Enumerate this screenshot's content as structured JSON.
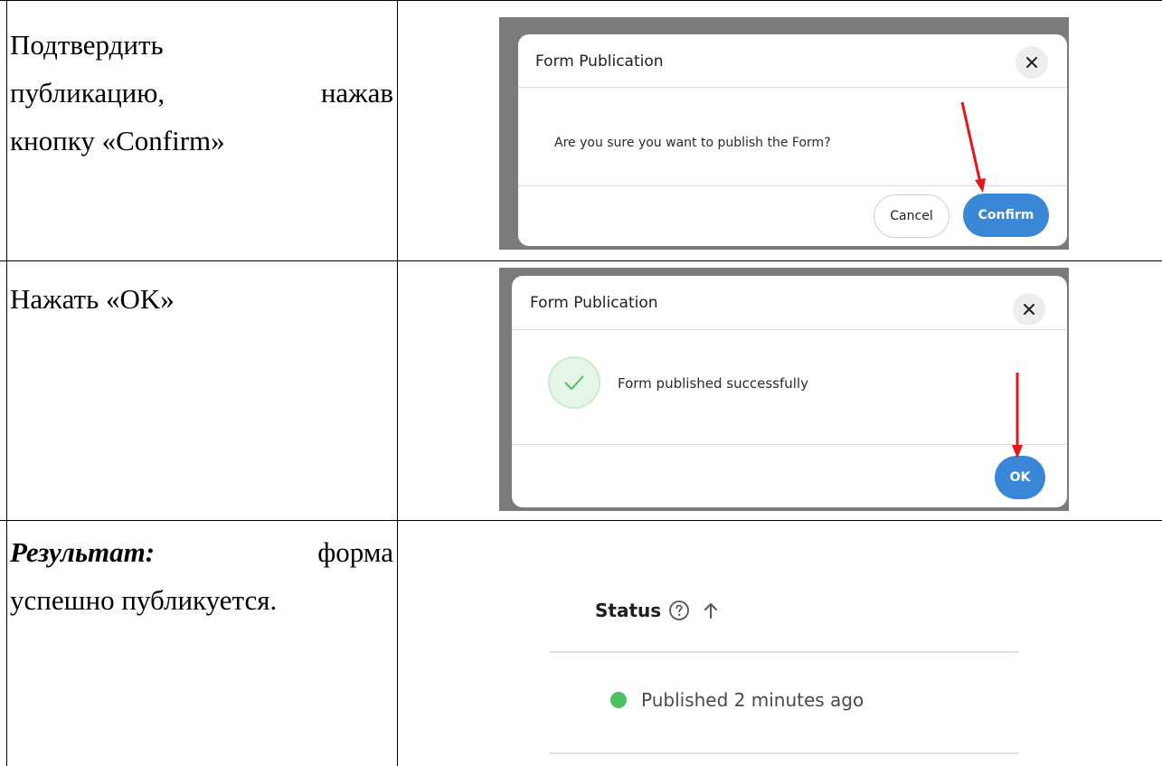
{
  "rows": [
    {
      "instruction_lines": [
        {
          "type": "plain",
          "text": "Подтвердить"
        },
        {
          "type": "justify",
          "left": "публикацию,",
          "right": "нажав"
        },
        {
          "type": "plain",
          "text": "кнопку «Confirm»"
        }
      ],
      "dialog": {
        "title": "Form Publication",
        "message": "Are you sure you want to publish the Form?",
        "cancel_label": "Cancel",
        "confirm_label": "Confirm"
      }
    },
    {
      "instruction_lines": [
        {
          "type": "plain",
          "text": "Нажать «OK»"
        }
      ],
      "dialog": {
        "title": "Form Publication",
        "message": "Form published successfully",
        "ok_label": "OK"
      }
    },
    {
      "result_label": "Результат:",
      "result_word": "форма",
      "result_line2": "успешно публикуется.",
      "status": {
        "header": "Status",
        "value": "Published 2 minutes ago",
        "dot_color": "#4cc063"
      }
    }
  ],
  "colors": {
    "accent_blue": "#3a87d8",
    "arrow_red": "#e8141c",
    "frame_gray": "#7b7b7b"
  }
}
